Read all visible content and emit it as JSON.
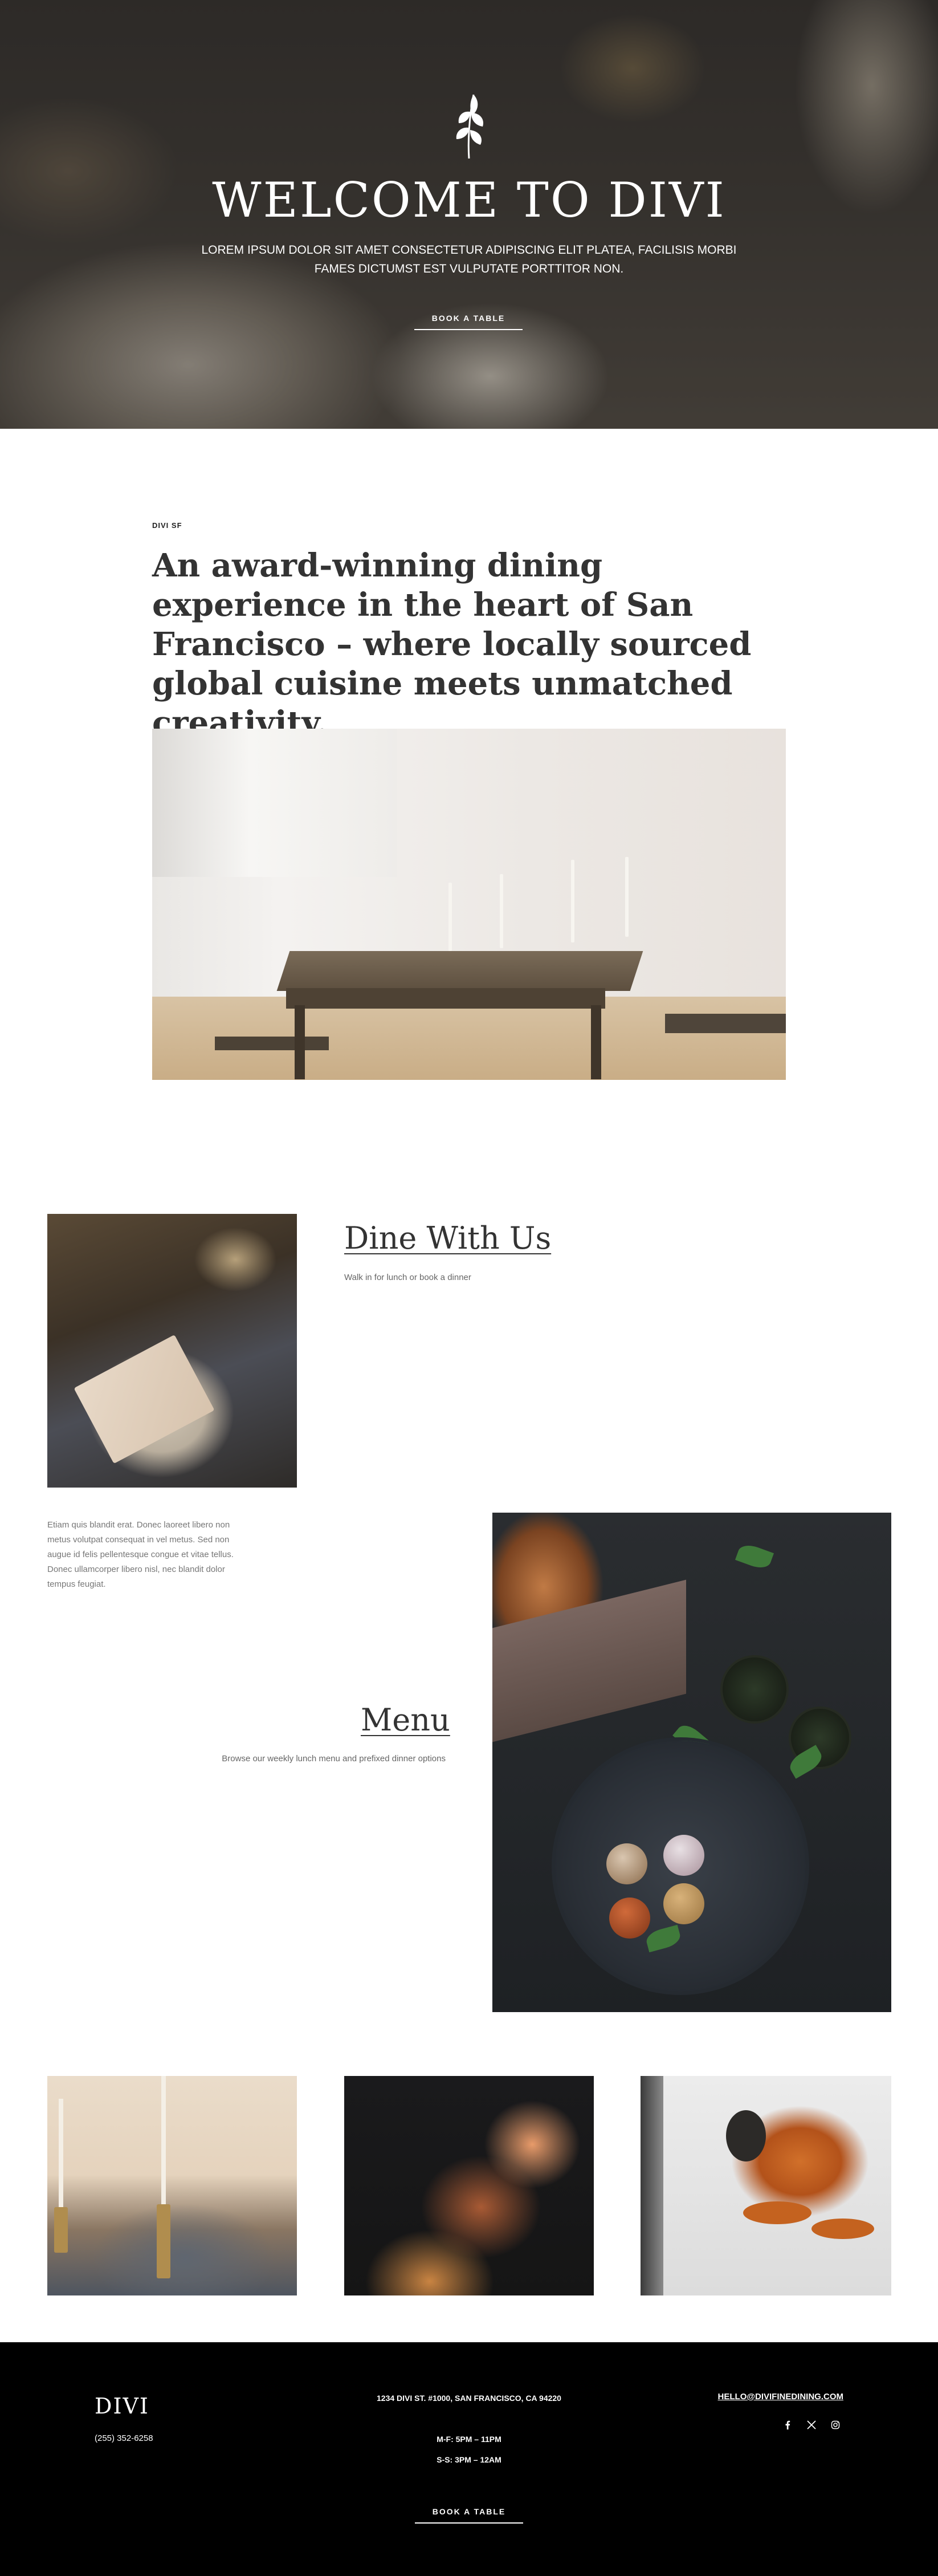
{
  "hero": {
    "title": "WELCOME TO DIVI",
    "subtitle": "LOREM IPSUM DOLOR SIT AMET CONSECTETUR ADIPISCING ELIT PLATEA, FACILISIS MORBI FAMES DICTUMST EST VULPUTATE PORTTITOR NON.",
    "button_label": "BOOK A TABLE",
    "icon": "leaf-sprig-icon"
  },
  "intro": {
    "eyebrow": "DIVI SF",
    "heading": "An award-winning dining experience in the heart of San Francisco – where locally sourced global cuisine meets unmatched creativity."
  },
  "dine": {
    "title": "Dine With Us",
    "subtitle": "Walk in for lunch or book a dinner",
    "body": "Etiam quis blandit erat. Donec laoreet libero non metus volutpat consequat in vel metus. Sed non augue id felis pellentesque congue et vitae tellus. Donec ullamcorper libero nisl, nec blandit dolor tempus feugiat."
  },
  "menu": {
    "title": "Menu",
    "subtitle": "Browse our weekly lunch menu and prefixed dinner options"
  },
  "footer": {
    "logo": "DIVI",
    "phone": "(255) 352-6258",
    "address": "1234 DIVI ST. #1000, SAN FRANCISCO, CA 94220",
    "hours_weekday": "M-F: 5PM – 11PM",
    "hours_weekend": "S-S: 3PM – 12AM",
    "email": "HELLO@DIVIFINEDINING.COM",
    "button_label": "BOOK A TABLE",
    "social_icons": [
      "facebook-icon",
      "x-icon",
      "instagram-icon"
    ]
  },
  "colors": {
    "text_dark": "#333333",
    "text_muted": "#666666",
    "footer_bg": "#000000",
    "white": "#ffffff"
  }
}
